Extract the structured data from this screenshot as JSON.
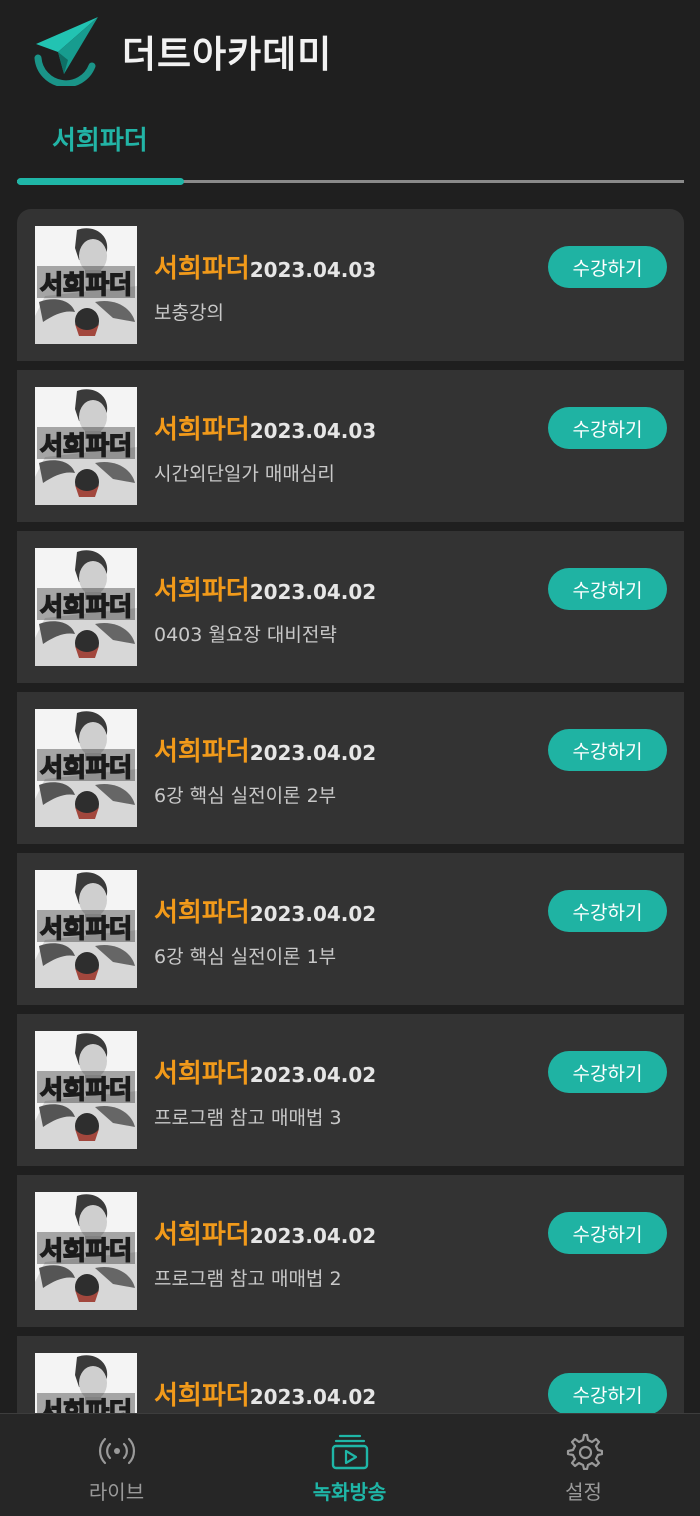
{
  "app": {
    "title": "더트아카데미"
  },
  "tabs": [
    {
      "label": "서희파더",
      "active": true
    }
  ],
  "thumbnail_text": "서희파더",
  "courses": [
    {
      "name": "서희파더",
      "date": "2023.04.03",
      "subtitle": "보충강의",
      "button": "수강하기"
    },
    {
      "name": "서희파더",
      "date": "2023.04.03",
      "subtitle": "시간외단일가 매매심리",
      "button": "수강하기"
    },
    {
      "name": "서희파더",
      "date": "2023.04.02",
      "subtitle": "0403 월요장 대비전략",
      "button": "수강하기"
    },
    {
      "name": "서희파더",
      "date": "2023.04.02",
      "subtitle": "6강 핵심 실전이론 2부",
      "button": "수강하기"
    },
    {
      "name": "서희파더",
      "date": "2023.04.02",
      "subtitle": "6강 핵심 실전이론 1부",
      "button": "수강하기"
    },
    {
      "name": "서희파더",
      "date": "2023.04.02",
      "subtitle": "프로그램 참고 매매법 3",
      "button": "수강하기"
    },
    {
      "name": "서희파더",
      "date": "2023.04.02",
      "subtitle": "프로그램 참고 매매법 2",
      "button": "수강하기"
    },
    {
      "name": "서희파더",
      "date": "2023.04.02",
      "subtitle": "",
      "button": "수강하기"
    }
  ],
  "bottom_nav": [
    {
      "label": "라이브",
      "icon": "live-broadcast-icon",
      "active": false
    },
    {
      "label": "녹화방송",
      "icon": "recorded-video-icon",
      "active": true
    },
    {
      "label": "설정",
      "icon": "gear-icon",
      "active": false
    }
  ],
  "colors": {
    "background": "#1f1f1f",
    "card": "#333333",
    "accent": "#1fb6a7",
    "course_name": "#f29a1a"
  }
}
